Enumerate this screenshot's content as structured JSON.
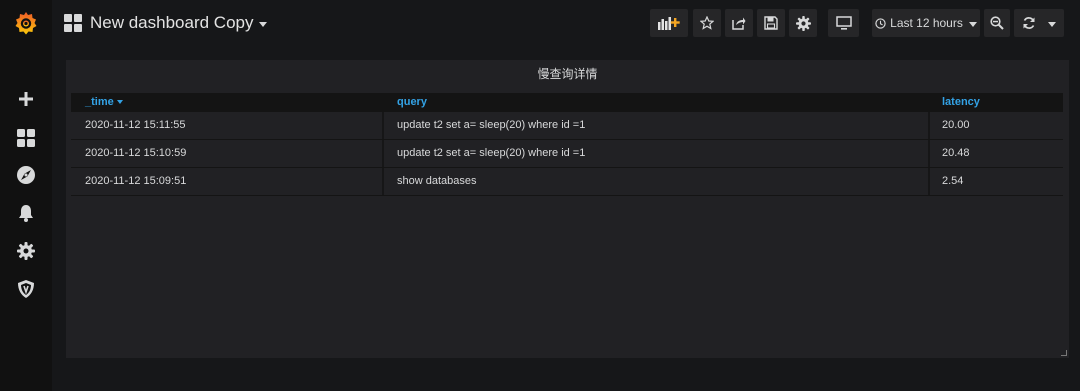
{
  "dashboard": {
    "title": "New dashboard Copy"
  },
  "sidemenu": {
    "items": [
      "grafana-logo-icon",
      "plus-icon",
      "dashboards-icon",
      "explore-icon",
      "alerting-icon",
      "configuration-icon",
      "shield-icon"
    ]
  },
  "toolbar": {
    "time_range_label": "Last 12 hours",
    "buttons": [
      "add-panel-icon",
      "star-icon",
      "share-icon",
      "save-icon",
      "settings-icon",
      "tv-icon",
      "clock-icon",
      "zoom-out-icon",
      "refresh-icon"
    ]
  },
  "panel": {
    "title": "慢查询详情",
    "columns": [
      "_time",
      "query",
      "latency"
    ],
    "rows": [
      {
        "time": "2020-11-12 15:11:55",
        "query": "update t2 set a= sleep(20) where id =1",
        "latency": "20.00"
      },
      {
        "time": "2020-11-12 15:10:59",
        "query": "update t2 set a= sleep(20) where id =1",
        "latency": "20.48"
      },
      {
        "time": "2020-11-12 15:09:51",
        "query": "show databases",
        "latency": "2.54"
      }
    ]
  },
  "colors": {
    "accent": "#33a2e5",
    "background": "#161719",
    "panel": "#212124",
    "logo": "#f05a28"
  }
}
